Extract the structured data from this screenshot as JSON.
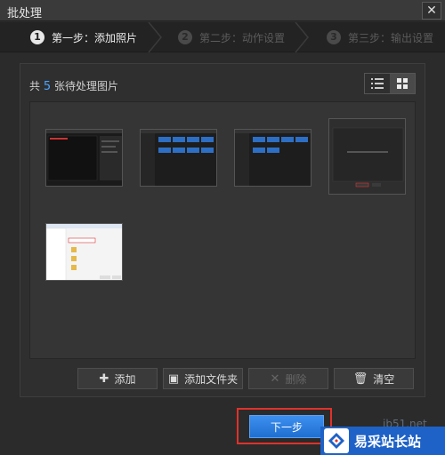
{
  "window": {
    "title": "批处理",
    "close_glyph": "✕"
  },
  "steps": [
    {
      "number": "1",
      "label": "第一步：添加照片",
      "state": "active"
    },
    {
      "number": "2",
      "label": "第二步：动作设置",
      "state": "inactive"
    },
    {
      "number": "3",
      "label": "第三步：输出设置",
      "state": "inactive"
    }
  ],
  "content": {
    "count_prefix": "共",
    "count_value": "5",
    "count_suffix": "张待处理图片",
    "view_modes": [
      "list-view-icon",
      "grid-view-icon"
    ]
  },
  "actions": [
    {
      "icon": "plus-icon",
      "glyph": "✚",
      "label": "添加",
      "enabled": true
    },
    {
      "icon": "folder-add-icon",
      "glyph": "▣",
      "label": "添加文件夹",
      "enabled": true
    },
    {
      "icon": "delete-icon",
      "glyph": "✕",
      "label": "删除",
      "enabled": false
    },
    {
      "icon": "trash-icon",
      "glyph": "🗑",
      "label": "清空",
      "enabled": true
    }
  ],
  "footer": {
    "next_label": "下一步"
  },
  "watermark": {
    "url": "jb51.net",
    "brand": "易采站长站"
  },
  "colors": {
    "accent": "#1f6fd0",
    "highlight": "#e0322b",
    "count_color": "#4aa3ff"
  }
}
